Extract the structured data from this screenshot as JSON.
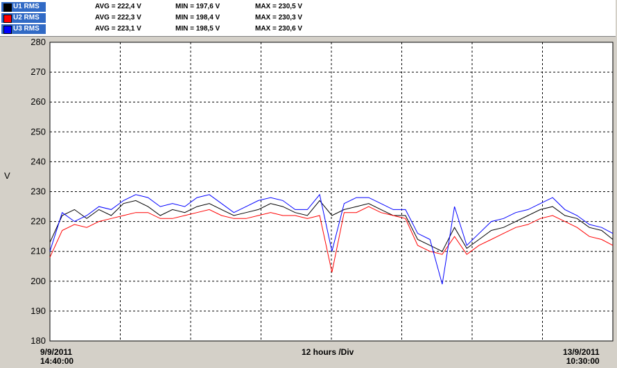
{
  "legend": [
    {
      "name": "U1 RMS",
      "color": "#000000",
      "avg": "AVG = 222,4 V",
      "min": "MIN = 197,6 V",
      "max": "MAX = 230,5 V"
    },
    {
      "name": "U2 RMS",
      "color": "#ff0000",
      "avg": "AVG = 222,3 V",
      "min": "MIN = 198,4 V",
      "max": "MAX = 230,3 V"
    },
    {
      "name": "U3 RMS",
      "color": "#0000ff",
      "avg": "AVG = 223,1 V",
      "min": "MIN = 198,5 V",
      "max": "MAX = 230,6 V"
    }
  ],
  "x_axis": {
    "start_date": "9/9/2011",
    "start_time": "14:40:00",
    "end_date": "13/9/2011",
    "end_time": "10:30:00",
    "division": "12 hours /Div"
  },
  "chart_data": {
    "type": "line",
    "ylabel": "V",
    "ylim": [
      180,
      280
    ],
    "yticks": [
      "180",
      "190",
      "200",
      "210",
      "220",
      "230",
      "240",
      "250",
      "260",
      "270",
      "280"
    ],
    "grid": true,
    "x_units": "hours from 9/9/2011 14:40:00",
    "x": [
      0,
      2,
      4,
      6,
      8,
      10,
      12,
      14,
      16,
      18,
      20,
      22,
      24,
      26,
      28,
      30,
      32,
      34,
      36,
      38,
      40,
      42,
      44,
      46,
      48,
      50,
      52,
      54,
      56,
      58,
      60,
      62,
      64,
      66,
      68,
      70,
      72,
      74,
      76,
      78,
      80,
      82,
      84,
      86,
      88,
      90,
      91.83
    ],
    "series": [
      {
        "name": "U1 RMS",
        "color": "#000000",
        "values": [
          213,
          222,
          224,
          221,
          224,
          222,
          226,
          227,
          225,
          222,
          224,
          223,
          225,
          226,
          224,
          222,
          223,
          224,
          226,
          225,
          223,
          222,
          227,
          222,
          224,
          225,
          226,
          224,
          222,
          222,
          214,
          212,
          210,
          218,
          211,
          214,
          217,
          218,
          220,
          222,
          224,
          225,
          222,
          221,
          218,
          217,
          214
        ]
      },
      {
        "name": "U2 RMS",
        "color": "#ff0000",
        "values": [
          208,
          217,
          219,
          218,
          220,
          221,
          222,
          223,
          223,
          221,
          221,
          222,
          223,
          224,
          222,
          221,
          221,
          222,
          223,
          222,
          222,
          221,
          222,
          203,
          223,
          223,
          225,
          223,
          222,
          221,
          212,
          210,
          209,
          215,
          209,
          212,
          214,
          216,
          218,
          219,
          221,
          222,
          220,
          218,
          215,
          214,
          212
        ]
      },
      {
        "name": "U3 RMS",
        "color": "#0000ff",
        "values": [
          210,
          223,
          220,
          222,
          225,
          224,
          227,
          229,
          228,
          225,
          226,
          225,
          228,
          229,
          226,
          223,
          225,
          227,
          228,
          227,
          224,
          224,
          229,
          210,
          226,
          228,
          228,
          226,
          224,
          224,
          216,
          214,
          199,
          225,
          212,
          216,
          220,
          221,
          223,
          224,
          226,
          228,
          224,
          222,
          219,
          218,
          216
        ]
      }
    ]
  }
}
